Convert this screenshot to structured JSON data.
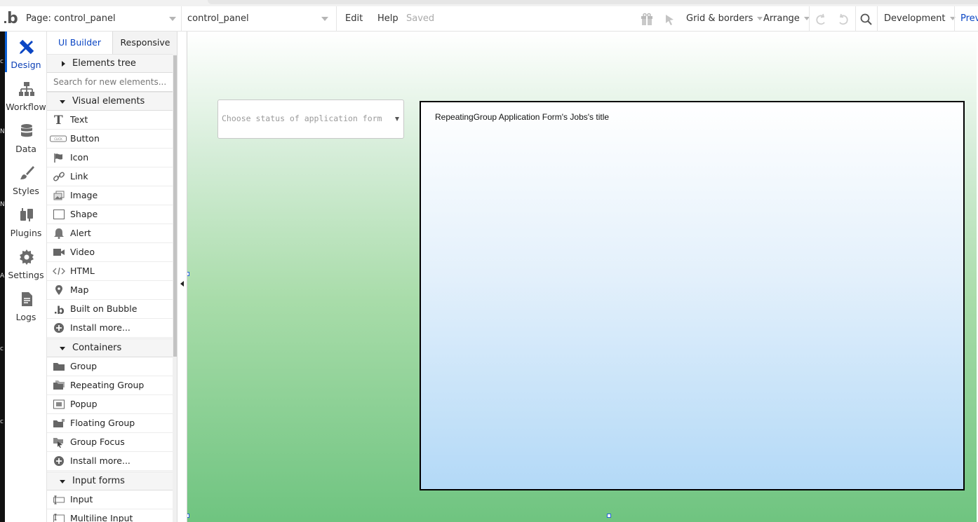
{
  "toolbar": {
    "page_label": "Page: control_panel",
    "page_select": "control_panel",
    "edit": "Edit",
    "help": "Help",
    "status": "Saved",
    "grid_borders": "Grid & borders",
    "arrange": "Arrange",
    "environment": "Development",
    "preview": "Prev"
  },
  "rail": {
    "items": [
      {
        "label": "Design",
        "icon": "design-icon"
      },
      {
        "label": "Workflow",
        "icon": "workflow-icon"
      },
      {
        "label": "Data",
        "icon": "database-icon"
      },
      {
        "label": "Styles",
        "icon": "brush-icon"
      },
      {
        "label": "Plugins",
        "icon": "plug-icon"
      },
      {
        "label": "Settings",
        "icon": "gear-icon"
      },
      {
        "label": "Logs",
        "icon": "document-icon"
      }
    ],
    "edge_letters": [
      "c",
      "N",
      "N",
      "A",
      "c",
      "c"
    ]
  },
  "panel": {
    "tabs": [
      "UI Builder",
      "Responsive"
    ],
    "elements_tree": "Elements tree",
    "search_placeholder": "Search for new elements...",
    "visual_header": "Visual elements",
    "visual_items": [
      "Text",
      "Button",
      "Icon",
      "Link",
      "Image",
      "Shape",
      "Alert",
      "Video",
      "HTML",
      "Map",
      "Built on Bubble",
      "Install more..."
    ],
    "button_icon_text": "CLICK",
    "containers_header": "Containers",
    "container_items": [
      "Group",
      "Repeating Group",
      "Popup",
      "Floating Group",
      "Group Focus",
      "Install more..."
    ],
    "input_header": "Input forms",
    "input_items": [
      "Input",
      "Multiline Input"
    ]
  },
  "canvas": {
    "dropdown_placeholder": "Choose status of application form",
    "repeating_group_title": "RepeatingGroup Application Form's Jobs's title"
  },
  "colors": {
    "accent": "#0b46c4",
    "canvas_top": "#ffffff",
    "canvas_bottom": "#6fc480",
    "rg_bottom": "#b3d9f7"
  }
}
